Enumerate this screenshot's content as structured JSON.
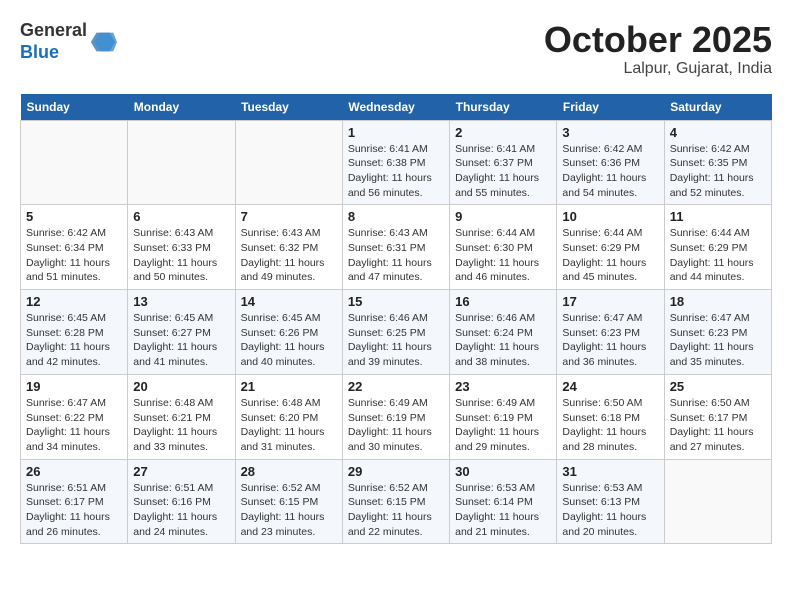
{
  "header": {
    "logo_line1": "General",
    "logo_line2": "Blue",
    "month": "October 2025",
    "location": "Lalpur, Gujarat, India"
  },
  "weekdays": [
    "Sunday",
    "Monday",
    "Tuesday",
    "Wednesday",
    "Thursday",
    "Friday",
    "Saturday"
  ],
  "weeks": [
    [
      {
        "day": "",
        "sunrise": "",
        "sunset": "",
        "daylight": ""
      },
      {
        "day": "",
        "sunrise": "",
        "sunset": "",
        "daylight": ""
      },
      {
        "day": "",
        "sunrise": "",
        "sunset": "",
        "daylight": ""
      },
      {
        "day": "1",
        "sunrise": "Sunrise: 6:41 AM",
        "sunset": "Sunset: 6:38 PM",
        "daylight": "Daylight: 11 hours and 56 minutes."
      },
      {
        "day": "2",
        "sunrise": "Sunrise: 6:41 AM",
        "sunset": "Sunset: 6:37 PM",
        "daylight": "Daylight: 11 hours and 55 minutes."
      },
      {
        "day": "3",
        "sunrise": "Sunrise: 6:42 AM",
        "sunset": "Sunset: 6:36 PM",
        "daylight": "Daylight: 11 hours and 54 minutes."
      },
      {
        "day": "4",
        "sunrise": "Sunrise: 6:42 AM",
        "sunset": "Sunset: 6:35 PM",
        "daylight": "Daylight: 11 hours and 52 minutes."
      }
    ],
    [
      {
        "day": "5",
        "sunrise": "Sunrise: 6:42 AM",
        "sunset": "Sunset: 6:34 PM",
        "daylight": "Daylight: 11 hours and 51 minutes."
      },
      {
        "day": "6",
        "sunrise": "Sunrise: 6:43 AM",
        "sunset": "Sunset: 6:33 PM",
        "daylight": "Daylight: 11 hours and 50 minutes."
      },
      {
        "day": "7",
        "sunrise": "Sunrise: 6:43 AM",
        "sunset": "Sunset: 6:32 PM",
        "daylight": "Daylight: 11 hours and 49 minutes."
      },
      {
        "day": "8",
        "sunrise": "Sunrise: 6:43 AM",
        "sunset": "Sunset: 6:31 PM",
        "daylight": "Daylight: 11 hours and 47 minutes."
      },
      {
        "day": "9",
        "sunrise": "Sunrise: 6:44 AM",
        "sunset": "Sunset: 6:30 PM",
        "daylight": "Daylight: 11 hours and 46 minutes."
      },
      {
        "day": "10",
        "sunrise": "Sunrise: 6:44 AM",
        "sunset": "Sunset: 6:29 PM",
        "daylight": "Daylight: 11 hours and 45 minutes."
      },
      {
        "day": "11",
        "sunrise": "Sunrise: 6:44 AM",
        "sunset": "Sunset: 6:29 PM",
        "daylight": "Daylight: 11 hours and 44 minutes."
      }
    ],
    [
      {
        "day": "12",
        "sunrise": "Sunrise: 6:45 AM",
        "sunset": "Sunset: 6:28 PM",
        "daylight": "Daylight: 11 hours and 42 minutes."
      },
      {
        "day": "13",
        "sunrise": "Sunrise: 6:45 AM",
        "sunset": "Sunset: 6:27 PM",
        "daylight": "Daylight: 11 hours and 41 minutes."
      },
      {
        "day": "14",
        "sunrise": "Sunrise: 6:45 AM",
        "sunset": "Sunset: 6:26 PM",
        "daylight": "Daylight: 11 hours and 40 minutes."
      },
      {
        "day": "15",
        "sunrise": "Sunrise: 6:46 AM",
        "sunset": "Sunset: 6:25 PM",
        "daylight": "Daylight: 11 hours and 39 minutes."
      },
      {
        "day": "16",
        "sunrise": "Sunrise: 6:46 AM",
        "sunset": "Sunset: 6:24 PM",
        "daylight": "Daylight: 11 hours and 38 minutes."
      },
      {
        "day": "17",
        "sunrise": "Sunrise: 6:47 AM",
        "sunset": "Sunset: 6:23 PM",
        "daylight": "Daylight: 11 hours and 36 minutes."
      },
      {
        "day": "18",
        "sunrise": "Sunrise: 6:47 AM",
        "sunset": "Sunset: 6:23 PM",
        "daylight": "Daylight: 11 hours and 35 minutes."
      }
    ],
    [
      {
        "day": "19",
        "sunrise": "Sunrise: 6:47 AM",
        "sunset": "Sunset: 6:22 PM",
        "daylight": "Daylight: 11 hours and 34 minutes."
      },
      {
        "day": "20",
        "sunrise": "Sunrise: 6:48 AM",
        "sunset": "Sunset: 6:21 PM",
        "daylight": "Daylight: 11 hours and 33 minutes."
      },
      {
        "day": "21",
        "sunrise": "Sunrise: 6:48 AM",
        "sunset": "Sunset: 6:20 PM",
        "daylight": "Daylight: 11 hours and 31 minutes."
      },
      {
        "day": "22",
        "sunrise": "Sunrise: 6:49 AM",
        "sunset": "Sunset: 6:19 PM",
        "daylight": "Daylight: 11 hours and 30 minutes."
      },
      {
        "day": "23",
        "sunrise": "Sunrise: 6:49 AM",
        "sunset": "Sunset: 6:19 PM",
        "daylight": "Daylight: 11 hours and 29 minutes."
      },
      {
        "day": "24",
        "sunrise": "Sunrise: 6:50 AM",
        "sunset": "Sunset: 6:18 PM",
        "daylight": "Daylight: 11 hours and 28 minutes."
      },
      {
        "day": "25",
        "sunrise": "Sunrise: 6:50 AM",
        "sunset": "Sunset: 6:17 PM",
        "daylight": "Daylight: 11 hours and 27 minutes."
      }
    ],
    [
      {
        "day": "26",
        "sunrise": "Sunrise: 6:51 AM",
        "sunset": "Sunset: 6:17 PM",
        "daylight": "Daylight: 11 hours and 26 minutes."
      },
      {
        "day": "27",
        "sunrise": "Sunrise: 6:51 AM",
        "sunset": "Sunset: 6:16 PM",
        "daylight": "Daylight: 11 hours and 24 minutes."
      },
      {
        "day": "28",
        "sunrise": "Sunrise: 6:52 AM",
        "sunset": "Sunset: 6:15 PM",
        "daylight": "Daylight: 11 hours and 23 minutes."
      },
      {
        "day": "29",
        "sunrise": "Sunrise: 6:52 AM",
        "sunset": "Sunset: 6:15 PM",
        "daylight": "Daylight: 11 hours and 22 minutes."
      },
      {
        "day": "30",
        "sunrise": "Sunrise: 6:53 AM",
        "sunset": "Sunset: 6:14 PM",
        "daylight": "Daylight: 11 hours and 21 minutes."
      },
      {
        "day": "31",
        "sunrise": "Sunrise: 6:53 AM",
        "sunset": "Sunset: 6:13 PM",
        "daylight": "Daylight: 11 hours and 20 minutes."
      },
      {
        "day": "",
        "sunrise": "",
        "sunset": "",
        "daylight": ""
      }
    ]
  ]
}
